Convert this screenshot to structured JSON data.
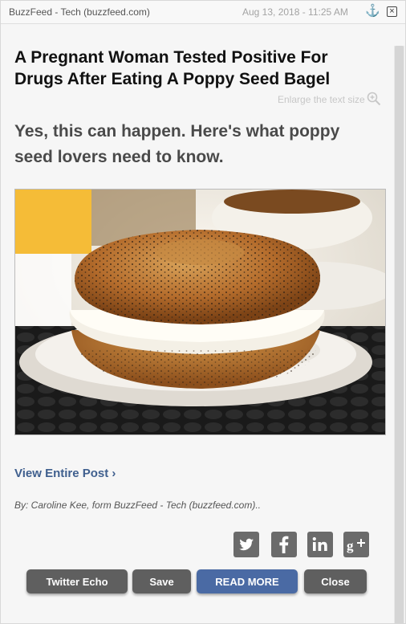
{
  "topbar": {
    "source": "BuzzFeed - Tech (buzzfeed.com)",
    "datetime": "Aug 13, 2018 - 11:25 AM",
    "close_glyph": "×"
  },
  "article": {
    "headline": "A Pregnant Woman Tested Positive For Drugs After Eating A Poppy Seed Bagel",
    "enlarge_label": "Enlarge the text size",
    "subhead": "Yes, this can happen. Here's what poppy seed lovers need to know.",
    "view_post": "View Entire Post ›",
    "byline": "By: Caroline Kee, form BuzzFeed - Tech (buzzfeed.com).."
  },
  "share_icons": [
    "twitter-icon",
    "facebook-icon",
    "linkedin-icon",
    "google-plus-icon"
  ],
  "buttons": {
    "twitter_echo": "Twitter Echo",
    "save": "Save",
    "read_more": "READ MORE",
    "close": "Close"
  },
  "colors": {
    "accent_blue": "#4a6aa4",
    "link_blue": "#3f5f8e",
    "button_gray": "#5f5f5f",
    "share_gray": "#6b6b6b"
  }
}
